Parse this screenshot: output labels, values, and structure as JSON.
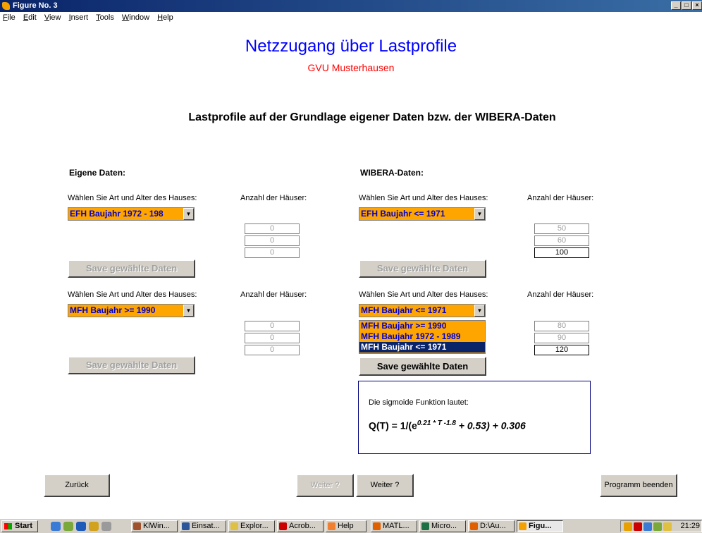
{
  "window": {
    "title": "Figure No. 3",
    "buttons": {
      "minimize": "_",
      "maximize": "□",
      "close": "×"
    }
  },
  "menu": [
    "File",
    "Edit",
    "View",
    "Insert",
    "Tools",
    "Window",
    "Help"
  ],
  "header": {
    "title": "Netzzugang über Lastprofile",
    "subtitle": "GVU Musterhausen",
    "heading": "Lastprofile auf der Grundlage eigener Daten bzw. der WIBERA-Daten"
  },
  "left": {
    "section": "Eigene Daten:",
    "block1": {
      "select_label": "Wählen Sie Art und Alter des Hauses:",
      "count_label": "Anzahl der Häuser:",
      "selected": "EFH Baujahr 1972 - 198",
      "values": [
        "0",
        "0",
        "0"
      ],
      "save": "Save gewählte Daten"
    },
    "block2": {
      "select_label": "Wählen Sie Art und Alter des Hauses:",
      "count_label": "Anzahl der Häuser:",
      "selected": "MFH Baujahr >= 1990",
      "values": [
        "0",
        "0",
        "0"
      ],
      "save": "Save gewählte Daten"
    }
  },
  "right": {
    "section": "WIBERA-Daten:",
    "block1": {
      "select_label": "Wählen Sie Art und Alter des Hauses:",
      "count_label": "Anzahl der Häuser:",
      "selected": "EFH Baujahr <= 1971",
      "values": [
        "50",
        "60",
        "100"
      ],
      "save": "Save gewählte Daten"
    },
    "block2": {
      "select_label": "Wählen Sie Art und Alter des Hauses:",
      "count_label": "Anzahl der Häuser:",
      "selected": "MFH Baujahr <= 1971",
      "options": [
        "MFH Baujahr >= 1990",
        "MFH Baujahr 1972 - 1989",
        "MFH Baujahr <= 1971"
      ],
      "values": [
        "80",
        "90",
        "120"
      ],
      "save": "Save gewählte Daten"
    }
  },
  "formula": {
    "text": "Die sigmoide Funktion lautet:",
    "lhs": "Q(T) = 1/(e",
    "exp": "0.21 * T  -1.8",
    "rhs": " + 0.53) + 0.306"
  },
  "nav": {
    "back": "Zurück",
    "next_disabled": "Weiter ?",
    "next": "Weiter ?",
    "quit": "Programm beenden"
  },
  "taskbar": {
    "start": "Start",
    "tasks": [
      "KlWin...",
      "Einsat...",
      "Explor...",
      "Acrob...",
      "Help",
      "MATL...",
      "Micro...",
      "D:\\Au...",
      "Figu..."
    ],
    "clock": "21:29"
  },
  "colors": {
    "title_blue": "#0000ff",
    "subtitle_red": "#ff0000",
    "dropdown_bg": "#ffa500",
    "dropdown_text": "#0000cc"
  }
}
